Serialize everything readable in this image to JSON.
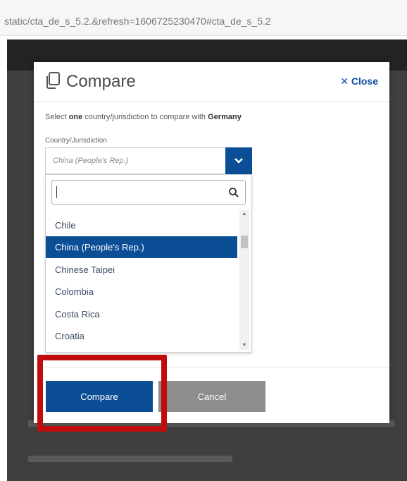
{
  "browser": {
    "url": "static/cta_de_s_5.2.&refresh=1606725230470#cta_de_s_5.2"
  },
  "modal": {
    "title": "Compare",
    "close_label": "Close",
    "instruction_prefix": "Select ",
    "instruction_bold": "one",
    "instruction_middle": " country/jurisdiction to compare with ",
    "instruction_country": "Germany",
    "field_label": "Country/Jurisdiction",
    "selected_value": "China (People's Rep.)",
    "search_value": "",
    "dropdown_items": [
      {
        "label": "Chile",
        "selected": false
      },
      {
        "label": "China (People's Rep.)",
        "selected": true
      },
      {
        "label": "Chinese Taipei",
        "selected": false
      },
      {
        "label": "Colombia",
        "selected": false
      },
      {
        "label": "Costa Rica",
        "selected": false
      },
      {
        "label": "Croatia",
        "selected": false
      }
    ],
    "compare_label": "Compare",
    "cancel_label": "Cancel"
  },
  "colors": {
    "primary": "#0b4e96",
    "cancel": "#8d8d8d",
    "highlight": "#c00c0c"
  },
  "icons": [
    "copy-icon",
    "close-x-icon",
    "chevron-down-icon",
    "search-icon",
    "scroll-up-arrow",
    "scroll-down-arrow"
  ]
}
